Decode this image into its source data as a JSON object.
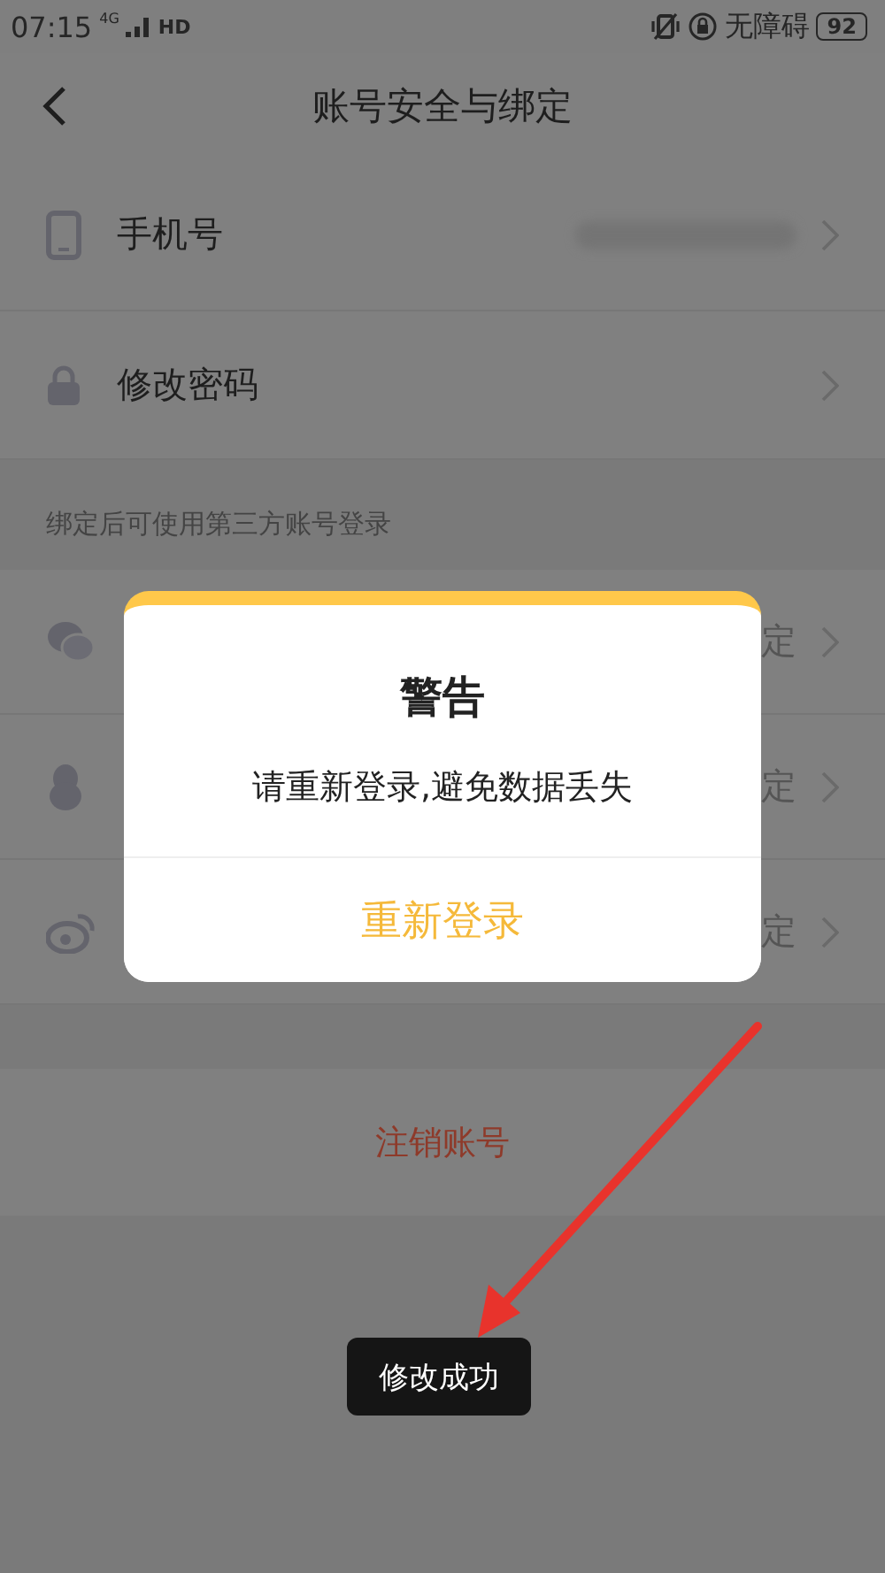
{
  "status_bar": {
    "time": "07:15",
    "network": "4G",
    "hd": "HD",
    "accessibility": "无障碍",
    "battery": "92"
  },
  "header": {
    "title": "账号安全与绑定"
  },
  "account_items": [
    {
      "kind": "phone",
      "label": "手机号"
    },
    {
      "kind": "password",
      "label": "修改密码"
    }
  ],
  "section_label": "绑定后可使用第三方账号登录",
  "third_party": [
    {
      "kind": "wechat",
      "status": "定"
    },
    {
      "kind": "qq",
      "status": "定"
    },
    {
      "kind": "weibo",
      "status": "定"
    }
  ],
  "logout": "注销账号",
  "dialog": {
    "title": "警告",
    "message": "请重新登录,避免数据丢失",
    "button": "重新登录"
  },
  "toast": "修改成功"
}
